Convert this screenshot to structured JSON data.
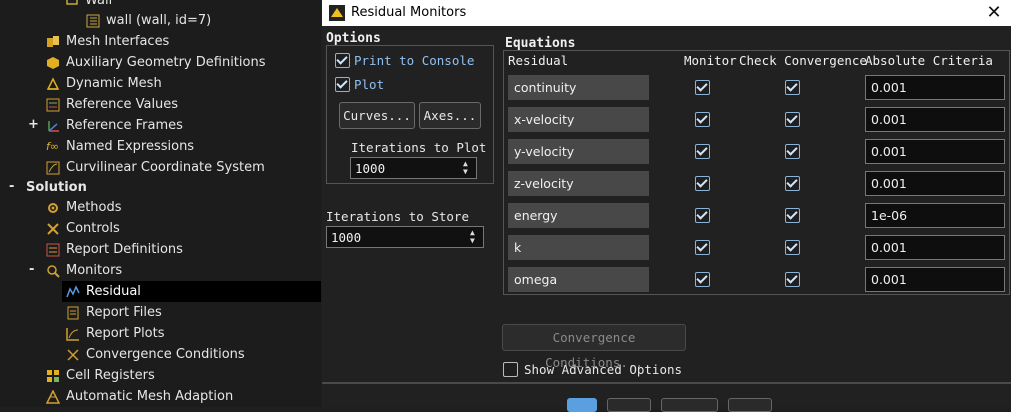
{
  "tree": {
    "items": [
      {
        "label": "Wall",
        "key": "wall-group-item"
      },
      {
        "label": "wall (wall, id=7)",
        "key": "wall-item"
      },
      {
        "label": "Mesh Interfaces",
        "key": "mesh-interfaces"
      },
      {
        "label": "Auxiliary Geometry Definitions",
        "key": "aux-geometry"
      },
      {
        "label": "Dynamic Mesh",
        "key": "dynamic-mesh"
      },
      {
        "label": "Reference Values",
        "key": "reference-values"
      },
      {
        "label": "Reference Frames",
        "key": "reference-frames"
      },
      {
        "label": "Named Expressions",
        "key": "named-expressions"
      },
      {
        "label": "Curvilinear Coordinate System",
        "key": "curvilinear"
      },
      {
        "label": "Solution",
        "key": "solution"
      },
      {
        "label": "Methods",
        "key": "methods"
      },
      {
        "label": "Controls",
        "key": "controls"
      },
      {
        "label": "Report Definitions",
        "key": "report-definitions"
      },
      {
        "label": "Monitors",
        "key": "monitors"
      },
      {
        "label": "Residual",
        "key": "residual"
      },
      {
        "label": "Report Files",
        "key": "report-files"
      },
      {
        "label": "Report Plots",
        "key": "report-plots"
      },
      {
        "label": "Convergence Conditions",
        "key": "convergence-conditions"
      },
      {
        "label": "Cell Registers",
        "key": "cell-registers"
      },
      {
        "label": "Automatic Mesh Adaption",
        "key": "mesh-adaption"
      }
    ],
    "expander_plus": "+",
    "expander_minus": "-"
  },
  "dialog": {
    "title": "Residual Monitors",
    "close_glyph": "✕",
    "options": {
      "group_label": "Options",
      "print_to_console": {
        "label": "Print to Console",
        "checked": true
      },
      "plot": {
        "label": "Plot",
        "checked": true
      },
      "curves_button": "Curves...",
      "axes_button": "Axes...",
      "iterations_to_plot_label": "Iterations to Plot",
      "iterations_to_plot_value": "1000",
      "iterations_to_store_label": "Iterations to Store",
      "iterations_to_store_value": "1000"
    },
    "equations": {
      "group_label": "Equations",
      "headers": {
        "residual": "Residual",
        "monitor": "Monitor",
        "check_convergence": "Check Convergence",
        "absolute_criteria": "Absolute Criteria"
      },
      "rows": [
        {
          "name": "continuity",
          "monitor": true,
          "check": true,
          "criteria": "0.001"
        },
        {
          "name": "x-velocity",
          "monitor": true,
          "check": true,
          "criteria": "0.001"
        },
        {
          "name": "y-velocity",
          "monitor": true,
          "check": true,
          "criteria": "0.001"
        },
        {
          "name": "z-velocity",
          "monitor": true,
          "check": true,
          "criteria": "0.001"
        },
        {
          "name": "energy",
          "monitor": true,
          "check": true,
          "criteria": "1e-06"
        },
        {
          "name": "k",
          "monitor": true,
          "check": true,
          "criteria": "0.001"
        },
        {
          "name": "omega",
          "monitor": true,
          "check": true,
          "criteria": "0.001"
        }
      ]
    },
    "convergence_conditions_button": "Convergence Conditions...",
    "show_advanced_options": {
      "label": "Show Advanced Options",
      "checked": false
    },
    "colors": {
      "accent": "#5aa0e0",
      "checkbox_label": "#8fc0f0"
    }
  }
}
